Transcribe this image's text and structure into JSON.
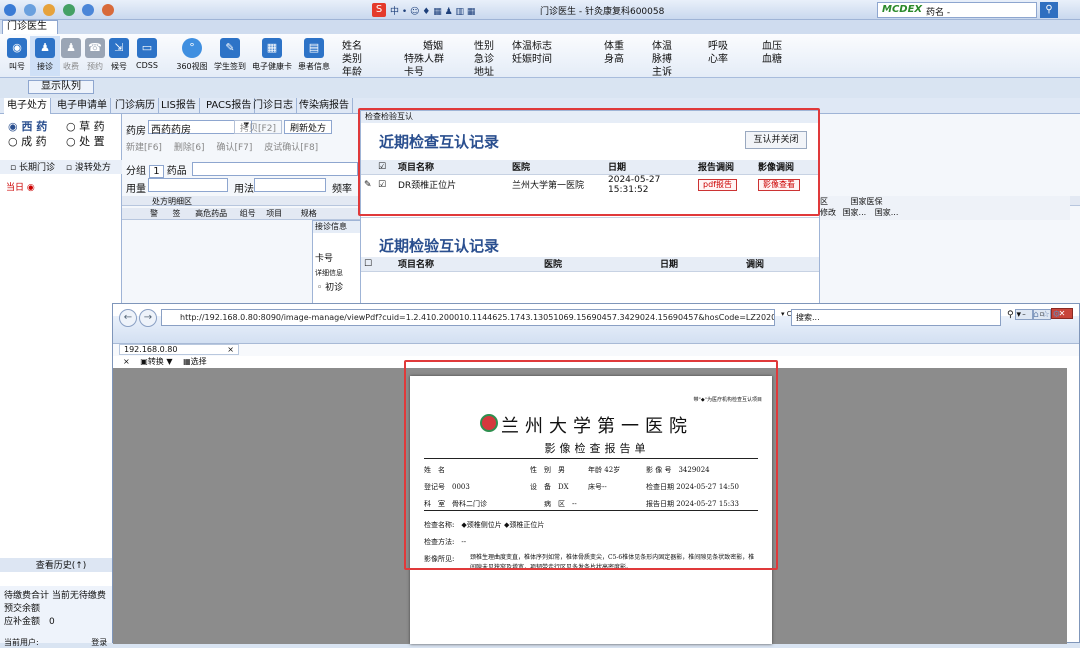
{
  "toolbar": {
    "title": "门诊医生 - 针灸康复科600058",
    "brand": "MCDEX",
    "drug_field": "药名 -"
  },
  "doc_tab": {
    "label": "门诊医生"
  },
  "ribbon": {
    "buttons": [
      "叫号",
      "接诊",
      "收费",
      "预约",
      "候号",
      "CDSS",
      "360视图",
      "学生签到",
      "电子健康卡",
      "患者信息"
    ],
    "patient_labels": {
      "name": "姓名",
      "category": "类别",
      "age": "年龄",
      "marriage": "婚姻",
      "special": "特殊人群",
      "card": "卡号",
      "gender": "性别",
      "urgent": "急诊",
      "address": "地址",
      "body": "体温标志",
      "pregnancy": "妊娠时间",
      "weight": "体重",
      "height": "身高",
      "temp": "体温",
      "pulse": "脉搏",
      "complaint": "主诉",
      "resp": "呼吸",
      "heart": "心率",
      "bp": "血压",
      "sugar": "血糖"
    }
  },
  "show_queue": "显示队列",
  "main_tabs": [
    "电子处方",
    "电子申请单",
    "门诊病历",
    "LIS报告",
    "PACS报告",
    "门诊日志",
    "传染病报告",
    "传染病报告登记",
    "当日挂号"
  ],
  "left": {
    "opt1": "西 药",
    "opt2": "草 药",
    "opt3": "成 药",
    "opt4": "处 置",
    "long_term": "长期门诊",
    "seal": "浚转处方",
    "today": "当日",
    "history": "查看历史(↑)",
    "fee_total": "待缴费合计",
    "fee_val": "当前无待缴费",
    "prepay": "预交余额",
    "insurance": "应补金额",
    "insurance_val": "0",
    "user": "当前用户:",
    "logout": "登录"
  },
  "rx": {
    "pharmacy_label": "药房",
    "pharmacy": "西药药房",
    "copy": "拷贝[F2]",
    "refresh": "刷新处方",
    "new": "新建[F6]",
    "delete": "删除[6]",
    "confirm": "确认[F7]",
    "skin": "皮试确认[F8]",
    "group_label": "分组",
    "group_val": "1",
    "drug_label": "药品",
    "dose": "用量",
    "usage": "用法",
    "freq": "频率",
    "area": "处方明细区",
    "cols": [
      "警",
      "签",
      "高危药品",
      "组号",
      "项目"
    ],
    "spec": "规格",
    "right_cols": [
      "区",
      "国家医保"
    ],
    "right_row": [
      "修改",
      "国家...",
      "国家..."
    ]
  },
  "receive": {
    "title": "接诊信息",
    "card": "卡号",
    "detail": "详细信息",
    "first": "初诊"
  },
  "popup": {
    "title": "检查检验互认",
    "exam_title": "近期检查互认记录",
    "close_btn": "互认并关闭",
    "exam_cols": [
      "项目名称",
      "医院",
      "日期",
      "报告调阅",
      "影像调阅"
    ],
    "exam_rows": [
      {
        "item": "DR颈椎正位片",
        "hospital": "兰州大学第一医院",
        "date": "2024-05-27 15:31:52",
        "report": "pdf报告",
        "image": "影像查看"
      }
    ],
    "lab_title": "近期检验互认记录",
    "lab_cols": [
      "项目名称",
      "医院",
      "日期",
      "调阅"
    ]
  },
  "browser": {
    "url": "http://192.168.0.80:8090/image-manage/viewPdf?cuid=1.2.410.200010.1144625.1743.13051069.15690457.3429024.15690457&hosCode=LZ20200806909336&appK",
    "search": "搜索...",
    "tab": "192.168.0.80",
    "tools": [
      "×",
      "转换",
      "选择"
    ]
  },
  "report": {
    "note": "带\"◆\"为医疗机构检查互认项目",
    "hospital": "兰州大学第一医院",
    "report_name": "影像检查报告单",
    "name_label": "姓　名",
    "gender_label": "性　别",
    "gender": "男",
    "age_label": "年龄",
    "age": "42岁",
    "image_no_label": "影 像 号",
    "image_no": "3429024",
    "reg_label": "登记号",
    "reg_no": "0003",
    "device_label": "设　备",
    "device": "DX",
    "bed_label": "床号",
    "bed": "--",
    "exam_date_label": "检查日期",
    "exam_date": "2024-05-27 14:50",
    "dept_label": "科　室",
    "dept": "骨科二门诊",
    "ward_label": "病　区",
    "ward": "--",
    "report_date_label": "报告日期",
    "report_date": "2024-05-27 15:33",
    "item_label": "检查名称:",
    "item": "◆颈椎侧位片 ◆颈椎正位片",
    "method_label": "检查方法:",
    "method": "--",
    "finding_label": "影像所见:",
    "finding": "颈椎生理曲度变直，椎体序列如常，椎体骨质变尖，C5-6椎体见条形内固定器影，椎间隙见条状致密影，椎间隙未见狭窄及增宽，项韧带走行区见多发条片状高密度影。"
  },
  "colors": {
    "accent": "#2a4f8f",
    "highlight": "#e0393a"
  }
}
